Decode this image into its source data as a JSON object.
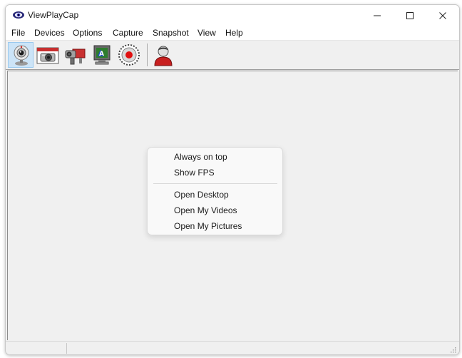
{
  "window": {
    "title": "ViewPlayCap",
    "controls": {
      "minimize": "minimize",
      "maximize": "maximize",
      "close": "close"
    }
  },
  "menubar": {
    "items": [
      "File",
      "Devices",
      "Options",
      "Capture",
      "Snapshot",
      "View",
      "Help"
    ]
  },
  "toolbar": {
    "buttons": [
      {
        "icon": "webcam-icon",
        "pressed": true
      },
      {
        "icon": "photo-camera-icon",
        "pressed": false
      },
      {
        "icon": "video-camera-icon",
        "pressed": false
      },
      {
        "icon": "desktop-monitor-icon",
        "pressed": false
      },
      {
        "icon": "record-icon",
        "pressed": false
      },
      {
        "icon": "user-icon",
        "pressed": false
      }
    ]
  },
  "context_menu": {
    "group1": [
      "Always on top",
      "Show FPS"
    ],
    "group2": [
      "Open Desktop",
      "Open My Videos",
      "Open My Pictures"
    ]
  },
  "colors": {
    "pressed_bg": "#cce4f7",
    "pressed_border": "#99c9ef",
    "record_red": "#e01010"
  }
}
